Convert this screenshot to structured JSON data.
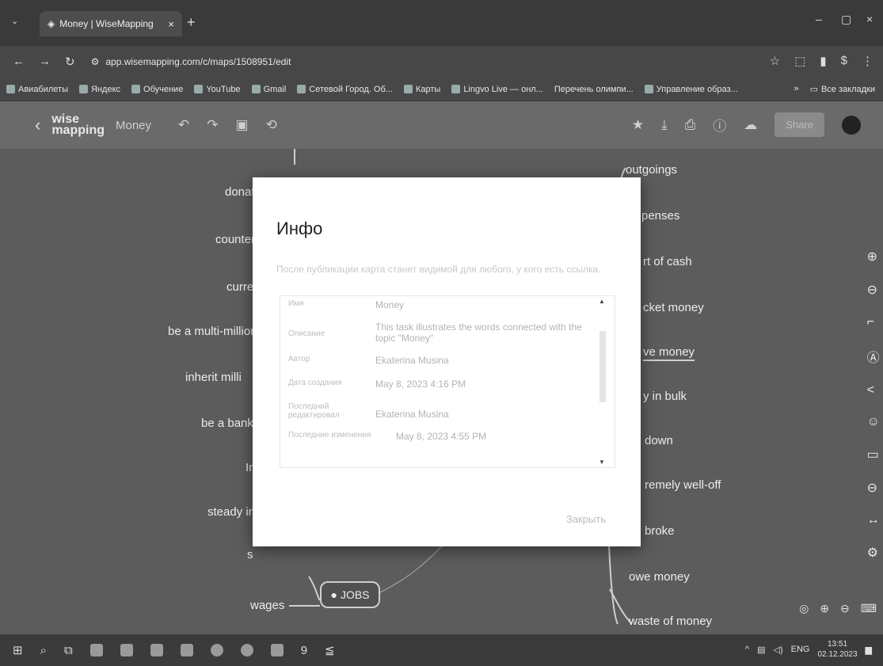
{
  "browser": {
    "tab_title": "Money | WiseMapping",
    "tab_close": "×",
    "new_tab": "+",
    "url": "app.wisemapping.com/c/maps/1508951/edit",
    "bookmarks": [
      "Авиабилеты",
      "Яндекс",
      "Обучение",
      "YouTube",
      "Gmail",
      "Сетевой Город. Об...",
      "Карты",
      "Lingvo Live — онл...",
      "Перечень олимпи...",
      "Управление образ..."
    ],
    "bookmarks_more": "»",
    "all_bookmarks": "Все закладки",
    "window_controls": [
      "–",
      "▢",
      "×"
    ]
  },
  "app": {
    "logo_line1": "wise",
    "logo_line2": "mapping",
    "map_name": "Money",
    "share_label": "Share"
  },
  "canvas": {
    "left_nodes": [
      "donat",
      "counter",
      "curre",
      "be a multi-million",
      "inherit milli",
      "be a bankr",
      "In",
      "steady in",
      "s",
      "wages"
    ],
    "right_nodes": [
      "outgoings",
      "penses",
      "rt of cash",
      "cket money",
      "ve money",
      "y in bulk",
      "down",
      "remely well-off",
      "broke",
      "owe money",
      "waste of money"
    ],
    "jobs_label": "JOBS"
  },
  "modal": {
    "title": "Инфо",
    "description": "После публикации карта станет видимой для любого, у кого есть ссылка.",
    "rows": [
      {
        "key": "Имя",
        "value": "Money"
      },
      {
        "key": "Описание",
        "value": "This task illustrates the words connected with the topic \"Money\""
      },
      {
        "key": "Автор",
        "value": "Ekaterina Musina"
      },
      {
        "key": "Дата создания",
        "value": "May 8, 2023 4:16 PM"
      },
      {
        "key": "Последний редактировал",
        "value": "Ekaterina Musina"
      },
      {
        "key": "Последние изменения",
        "value": "May 8, 2023 4:55 PM"
      }
    ],
    "close_label": "Закрыть"
  },
  "taskbar": {
    "lang": "ENG",
    "time": "13:51",
    "date": "02.12.2023"
  }
}
